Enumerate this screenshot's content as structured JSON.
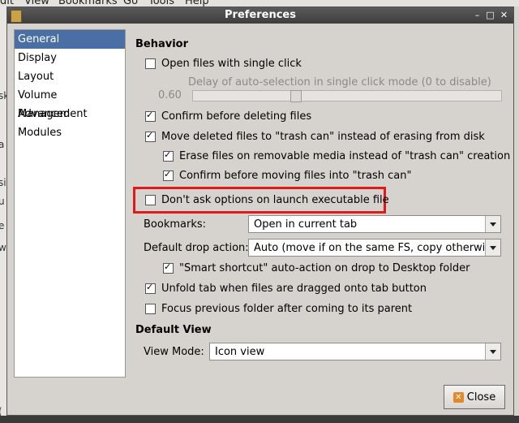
{
  "background": {
    "menu": [
      "dit",
      "View",
      "Bookmarks",
      "Go",
      "Tools",
      "Help"
    ],
    "left_fragments": [
      "sk",
      "a",
      "si",
      "u",
      "e",
      "w",
      "("
    ]
  },
  "window": {
    "title": "Preferences",
    "minimize_glyph": "–",
    "maximize_glyph": "□",
    "close_glyph": "✕"
  },
  "sidebar": {
    "items": [
      {
        "label": "General",
        "active": true
      },
      {
        "label": "Display"
      },
      {
        "label": "Layout"
      },
      {
        "label": "Volume Management"
      },
      {
        "label": "Advanced"
      },
      {
        "label": "Modules"
      }
    ]
  },
  "behavior": {
    "title": "Behavior",
    "open_single_click": {
      "label": "Open files with single click",
      "checked": false
    },
    "delay_label": "Delay of auto-selection in single click mode (0 to disable)",
    "delay_value": "0.60",
    "confirm_delete": {
      "label": "Confirm before deleting files",
      "checked": true
    },
    "move_to_trash": {
      "label": "Move deleted files to \"trash can\" instead of erasing from disk",
      "checked": true
    },
    "erase_removable": {
      "label": "Erase files on removable media instead of \"trash can\" creation",
      "checked": true
    },
    "confirm_trash": {
      "label": "Confirm before moving files into \"trash can\"",
      "checked": true
    },
    "dont_ask_exec": {
      "label": "Don't ask options on launch executable file",
      "checked": false
    },
    "bookmarks_label": "Bookmarks:",
    "bookmarks_value": "Open in current tab",
    "drop_label": "Default drop action:",
    "drop_value": "Auto (move if on the same FS, copy otherwise)",
    "smart_shortcut": {
      "label": "\"Smart shortcut\" auto-action on drop to Desktop folder",
      "checked": true
    },
    "unfold_tab": {
      "label": "Unfold tab when files are dragged onto tab button",
      "checked": true
    },
    "focus_previous": {
      "label": "Focus previous folder after coming to its parent",
      "checked": false
    }
  },
  "default_view": {
    "title": "Default View",
    "view_mode_label": "View Mode:",
    "view_mode_value": "Icon view"
  },
  "footer": {
    "close_label": "Close",
    "close_icon_glyph": "✕"
  }
}
